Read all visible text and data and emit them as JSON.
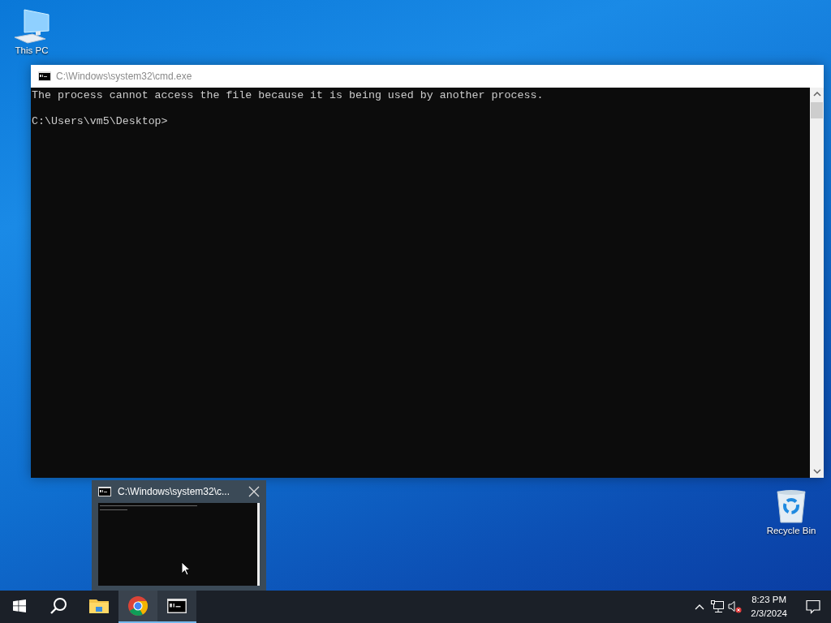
{
  "desktop_icons": [
    {
      "kind": "computer",
      "label": "This PC"
    },
    {
      "kind": "recycle",
      "label": "Recycle Bin"
    }
  ],
  "window": {
    "title": "C:\\Windows\\system32\\cmd.exe",
    "active": false,
    "message": "The process cannot access the file because it is being used by another process.",
    "prompt": "C:\\Users\\vm5\\Desktop>"
  },
  "preview": {
    "title": "C:\\Windows\\system32\\c..."
  },
  "taskbar": {
    "apps": [
      {
        "kind": "explorer",
        "running": false,
        "active": false,
        "hovered": false
      },
      {
        "kind": "chrome",
        "running": true,
        "active": true,
        "hovered": false
      },
      {
        "kind": "cmd",
        "running": true,
        "active": false,
        "hovered": true
      }
    ],
    "clock": {
      "time": "8:23 PM",
      "date": "2/3/2024"
    },
    "volume_muted": true
  }
}
